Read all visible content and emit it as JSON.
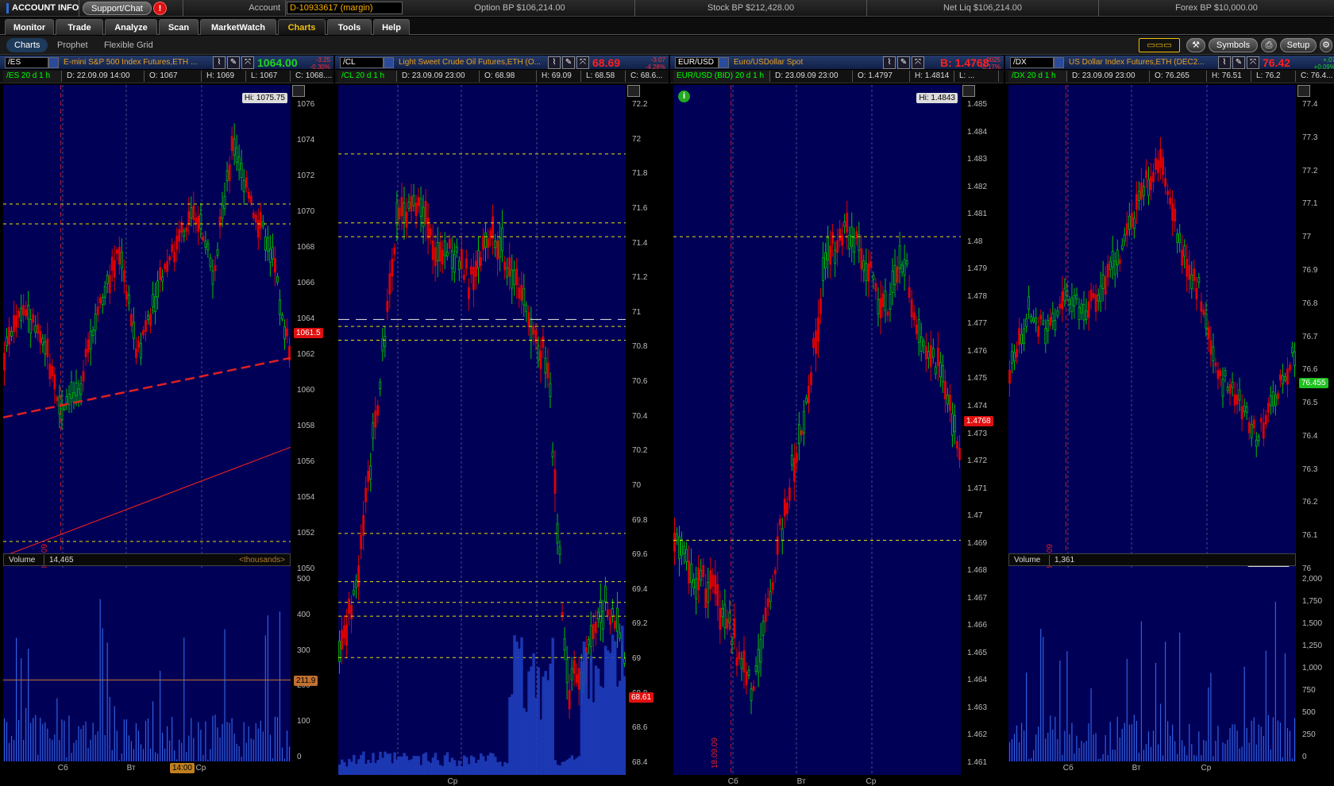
{
  "account_bar": {
    "account_info": "ACCOUNT INFO",
    "support_chat": "Support/Chat",
    "alert_icon": "!",
    "account_label": "Account",
    "account_value": "D-10933617 (margin)",
    "option_bp": "Option BP  $106,214.00",
    "stock_bp": "Stock BP  $212,428.00",
    "net_liq": "Net Liq  $106,214.00",
    "forex_bp": "Forex BP  $10,000.00"
  },
  "main_tabs": [
    "Monitor",
    "Trade",
    "Analyze",
    "Scan",
    "MarketWatch",
    "Charts",
    "Tools",
    "Help"
  ],
  "main_tab_active": "Charts",
  "sub_tabs": [
    "Charts",
    "Prophet",
    "Flexible Grid"
  ],
  "toolbar": {
    "symbols": "Symbols",
    "setup": "Setup"
  },
  "colors": {
    "plot_bg": "#000057",
    "up": "#00c000",
    "down": "#e00000",
    "level_line": "#e8e000",
    "accent": "#f0c010"
  },
  "charts": [
    {
      "symbol": "/ES",
      "title": "E-mini S&P 500 Index Futures,ETH ...",
      "price": "1064.00",
      "price_color": "#1fd41f",
      "change": "-3.25",
      "change_pct": "-0.30%",
      "ohlc": {
        "label": "/ES 20 d 1 h",
        "d": "D: 22.09.09 14:00",
        "o": "O: 1067",
        "h": "H: 1069",
        "l": "L: 1067",
        "c": "C: 1068...."
      },
      "yaxis": [
        "1076",
        "1074",
        "1072",
        "1070",
        "1068",
        "1066",
        "1064",
        "1062",
        "1060",
        "1058",
        "1056",
        "1054",
        "1052",
        "1050"
      ],
      "current_tag": "1061.5",
      "hi_tag": "Hi: 1075.75",
      "date_marker": "18.09.09",
      "volume": {
        "label": "Volume",
        "value": "14,465",
        "units": "<thousands>",
        "yaxis": [
          "500",
          "400",
          "300",
          "200",
          "100",
          "0"
        ],
        "tag": "211.9"
      },
      "xlabels": [
        "Сб",
        "Вт",
        "Ср"
      ],
      "xhighlight": "14:00"
    },
    {
      "symbol": "/CL",
      "title": "Light Sweet Crude Oil Futures,ETH (O...",
      "price": "68.69",
      "price_color": "#ff2020",
      "change": "-3.07",
      "change_pct": "-4.28%",
      "ohlc": {
        "label": "/CL 20 d 1 h",
        "d": "D: 23.09.09 23:00",
        "o": "O: 68.98",
        "h": "H: 69.09",
        "l": "L: 68.58",
        "c": "C: 68.6..."
      },
      "yaxis": [
        "72.2",
        "72",
        "71.8",
        "71.6",
        "71.4",
        "71.2",
        "71",
        "70.8",
        "70.6",
        "70.4",
        "70.2",
        "70",
        "69.8",
        "69.6",
        "69.4",
        "69.2",
        "69",
        "68.8",
        "68.6",
        "68.4"
      ],
      "current_tag": "68.61",
      "xlabels": [
        "Ср"
      ]
    },
    {
      "symbol": "EUR/USD",
      "title": "Euro/USDollar Spot",
      "price": "B: 1.4768",
      "price_color": "#ff2020",
      "change": "-.0025",
      "change_pct": "-0.17%",
      "ohlc": {
        "label": "EUR/USD (BID) 20 d 1 h",
        "d": "D: 23.09.09 23:00",
        "o": "O: 1.4797",
        "h": "H: 1.4814",
        "l": "L: ..."
      },
      "yaxis": [
        "1.485",
        "1.484",
        "1.483",
        "1.482",
        "1.481",
        "1.48",
        "1.479",
        "1.478",
        "1.477",
        "1.476",
        "1.475",
        "1.474",
        "1.473",
        "1.472",
        "1.471",
        "1.47",
        "1.469",
        "1.468",
        "1.467",
        "1.466",
        "1.465",
        "1.464",
        "1.463",
        "1.462",
        "1.461"
      ],
      "current_tag": "1.4768",
      "hi_tag": "Hi: 1.4843",
      "date_marker": "18.09.09",
      "xlabels": [
        "Сб",
        "Вт",
        "Ср"
      ]
    },
    {
      "symbol": "/DX",
      "title": "US Dollar Index Futures,ETH (DEC2...",
      "price": "76.42",
      "price_color": "#ff2020",
      "change": "+.07",
      "change_pct": "+0.09%",
      "ohlc": {
        "label": "/DX 20 d 1 h",
        "d": "D: 23.09.09 23:00",
        "o": "O: 76.265",
        "h": "H: 76.51",
        "l": "L: 76.2",
        "c": "C: 76.4..."
      },
      "yaxis": [
        "77.4",
        "77.3",
        "77.2",
        "77.1",
        "77",
        "76.9",
        "76.8",
        "76.7",
        "76.6",
        "76.5",
        "76.4",
        "76.3",
        "76.2",
        "76.1",
        "76"
      ],
      "current_tag": "76.455",
      "lo_tag": "Lo: 76.045",
      "date_marker": "18.09.09",
      "volume": {
        "label": "Volume",
        "value": "1,361",
        "yaxis": [
          "2,000",
          "1,750",
          "1,500",
          "1,250",
          "1,000",
          "750",
          "500",
          "250",
          "0"
        ]
      },
      "xlabels": [
        "Сб",
        "Вт",
        "Ср"
      ]
    }
  ]
}
